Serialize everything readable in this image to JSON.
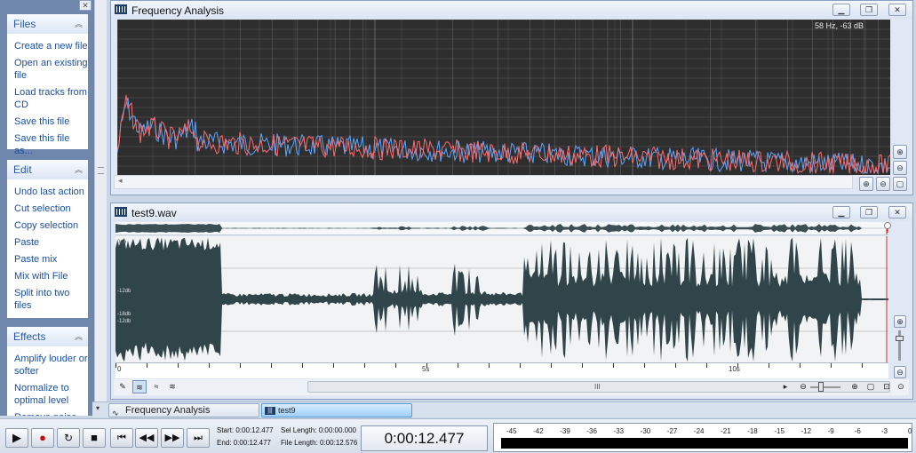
{
  "taskpane": {
    "close_glyph": "✕",
    "groups": [
      {
        "title": "Files",
        "items": [
          "Create a new file",
          "Open an existing file",
          "Load tracks from CD",
          "Save this file",
          "Save this file as..."
        ]
      },
      {
        "title": "Edit",
        "items": [
          "Undo last action",
          "Cut selection",
          "Copy selection",
          "Paste",
          "Paste mix",
          "Mix with File",
          "Split into two files"
        ]
      },
      {
        "title": "Effects",
        "items": [
          "Amplify louder or softer",
          "Normalize to optimal level",
          "Remove noise or"
        ]
      }
    ]
  },
  "freq_window": {
    "title": "Frequency Analysis",
    "readout": "58 Hz, -63 dB"
  },
  "wave_window": {
    "title": "test9.wav",
    "db_labels": [
      "0db",
      "-12db",
      "-18db",
      "-12db"
    ],
    "ruler": [
      "0",
      "5s",
      "10s"
    ],
    "scroll_grip": "III"
  },
  "doctabs": [
    {
      "label": "Frequency Analysis",
      "active": false
    },
    {
      "label": "test9",
      "active": true
    }
  ],
  "transport": {
    "start_label": "Start:",
    "start_value": "0:00:12.477",
    "end_label": "End:",
    "end_value": "0:00:12.477",
    "sel_length_label": "Sel Length:",
    "sel_length_value": "0:00:00.000",
    "file_length_label": "File Length:",
    "file_length_value": "0:00:12.576",
    "time": "0:00:12.477",
    "meter_scale": [
      "-45",
      "-42",
      "-39",
      "-36",
      "-33",
      "-30",
      "-27",
      "-24",
      "-21",
      "-18",
      "-15",
      "-12",
      "-9",
      "-6",
      "-3",
      "0"
    ]
  },
  "colors": {
    "spectrum_bg": "#2e2e2e",
    "spectrum_red": "#ff6b6b",
    "spectrum_blue": "#5aa6ff",
    "wave_fill": "#2f454a",
    "cursor": "#e02020"
  }
}
